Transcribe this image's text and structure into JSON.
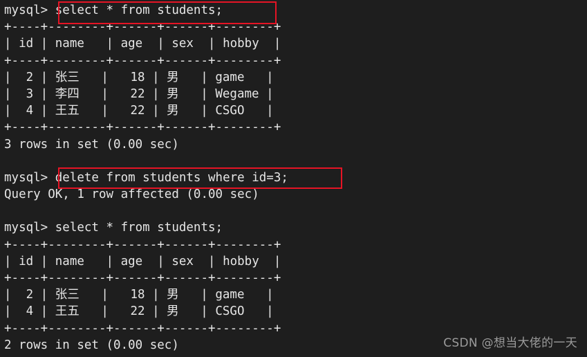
{
  "terminal": {
    "background_color": "#1e1e1e",
    "text_color": "#e6e6e6",
    "prompt": "mysql> ",
    "highlight_color": "#e61425",
    "lines": [
      "mysql> select * from students;",
      "+----+--------+------+------+--------+",
      "| id | name   | age  | sex  | hobby  |",
      "+----+--------+------+------+--------+",
      "|  2 | 张三   |   18 | 男   | game   |",
      "|  3 | 李四   |   22 | 男   | Wegame |",
      "|  4 | 王五   |   22 | 男   | CSGO   |",
      "+----+--------+------+------+--------+",
      "3 rows in set (0.00 sec)",
      "",
      "mysql> delete from students where id=3;",
      "Query OK, 1 row affected (0.00 sec)",
      "",
      "mysql> select * from students;",
      "+----+--------+------+------+--------+",
      "| id | name   | age  | sex  | hobby  |",
      "+----+--------+------+------+--------+",
      "|  2 | 张三   |   18 | 男   | game   |",
      "|  4 | 王五   |   22 | 男   | CSGO   |",
      "+----+--------+------+------+--------+",
      "2 rows in set (0.00 sec)"
    ]
  },
  "commands": {
    "first_select": "select * from students;",
    "delete": "delete from students where id=3;",
    "second_select": "select * from students;"
  },
  "results": {
    "columns": [
      "id",
      "name",
      "age",
      "sex",
      "hobby"
    ],
    "before_delete": {
      "rows": [
        [
          "2",
          "张三",
          "18",
          "男",
          "game"
        ],
        [
          "3",
          "李四",
          "22",
          "男",
          "Wegame"
        ],
        [
          "4",
          "王五",
          "22",
          "男",
          "CSGO"
        ]
      ],
      "footer": "3 rows in set (0.00 sec)"
    },
    "delete_status": "Query OK, 1 row affected (0.00 sec)",
    "after_delete": {
      "rows": [
        [
          "2",
          "张三",
          "18",
          "男",
          "game"
        ],
        [
          "4",
          "王五",
          "22",
          "男",
          "CSGO"
        ]
      ],
      "footer": "2 rows in set (0.00 sec)"
    }
  },
  "watermark": {
    "text": "CSDN @想当大佬的一天"
  }
}
